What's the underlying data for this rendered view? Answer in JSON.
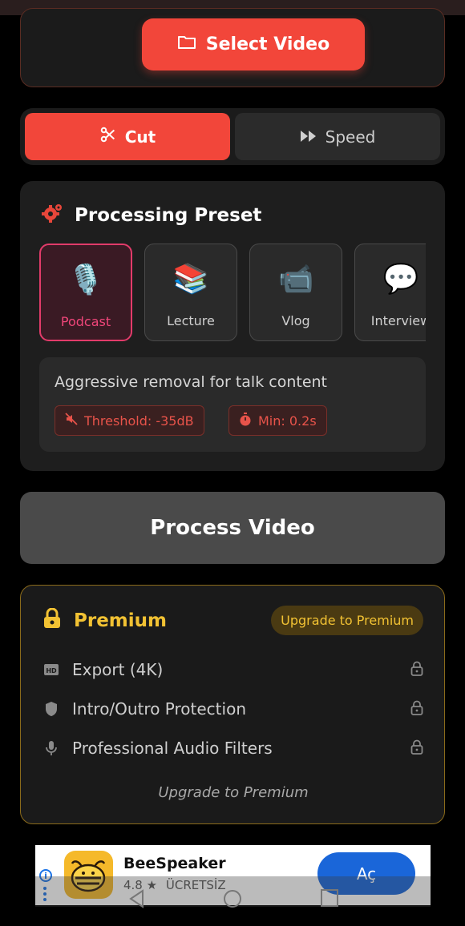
{
  "select": {
    "label": "Select Video",
    "icon": "folder-icon"
  },
  "tabs": [
    {
      "label": "Cut",
      "icon": "scissors-icon",
      "active": true
    },
    {
      "label": "Speed",
      "icon": "fast-forward-icon",
      "active": false
    }
  ],
  "preset": {
    "title": "Processing Preset",
    "icon": "gear-icon",
    "items": [
      {
        "label": "Podcast",
        "emoji": "🎙️",
        "selected": true
      },
      {
        "label": "Lecture",
        "emoji": "📚",
        "selected": false
      },
      {
        "label": "Vlog",
        "emoji": "📹",
        "selected": false
      },
      {
        "label": "Interview",
        "emoji": "💬",
        "selected": false
      }
    ],
    "description": "Aggressive removal for talk content",
    "threshold": "Threshold: -35dB",
    "min": "Min: 0.2s"
  },
  "process": {
    "label": "Process Video"
  },
  "premium": {
    "title": "Premium",
    "upgrade_badge": "Upgrade to Premium",
    "features": [
      {
        "label": "Export (4K)",
        "icon": "hd-icon"
      },
      {
        "label": "Intro/Outro Protection",
        "icon": "shield-icon"
      },
      {
        "label": "Professional Audio Filters",
        "icon": "microphone-icon"
      }
    ],
    "footer": "Upgrade to Premium"
  },
  "ad": {
    "app_name": "BeeSpeaker",
    "rating": "4.8",
    "price": "ÜCRETSİZ",
    "button": "Aç"
  },
  "colors": {
    "accent": "#f2463a",
    "gold": "#f2c233",
    "pink": "#e23b6a"
  }
}
